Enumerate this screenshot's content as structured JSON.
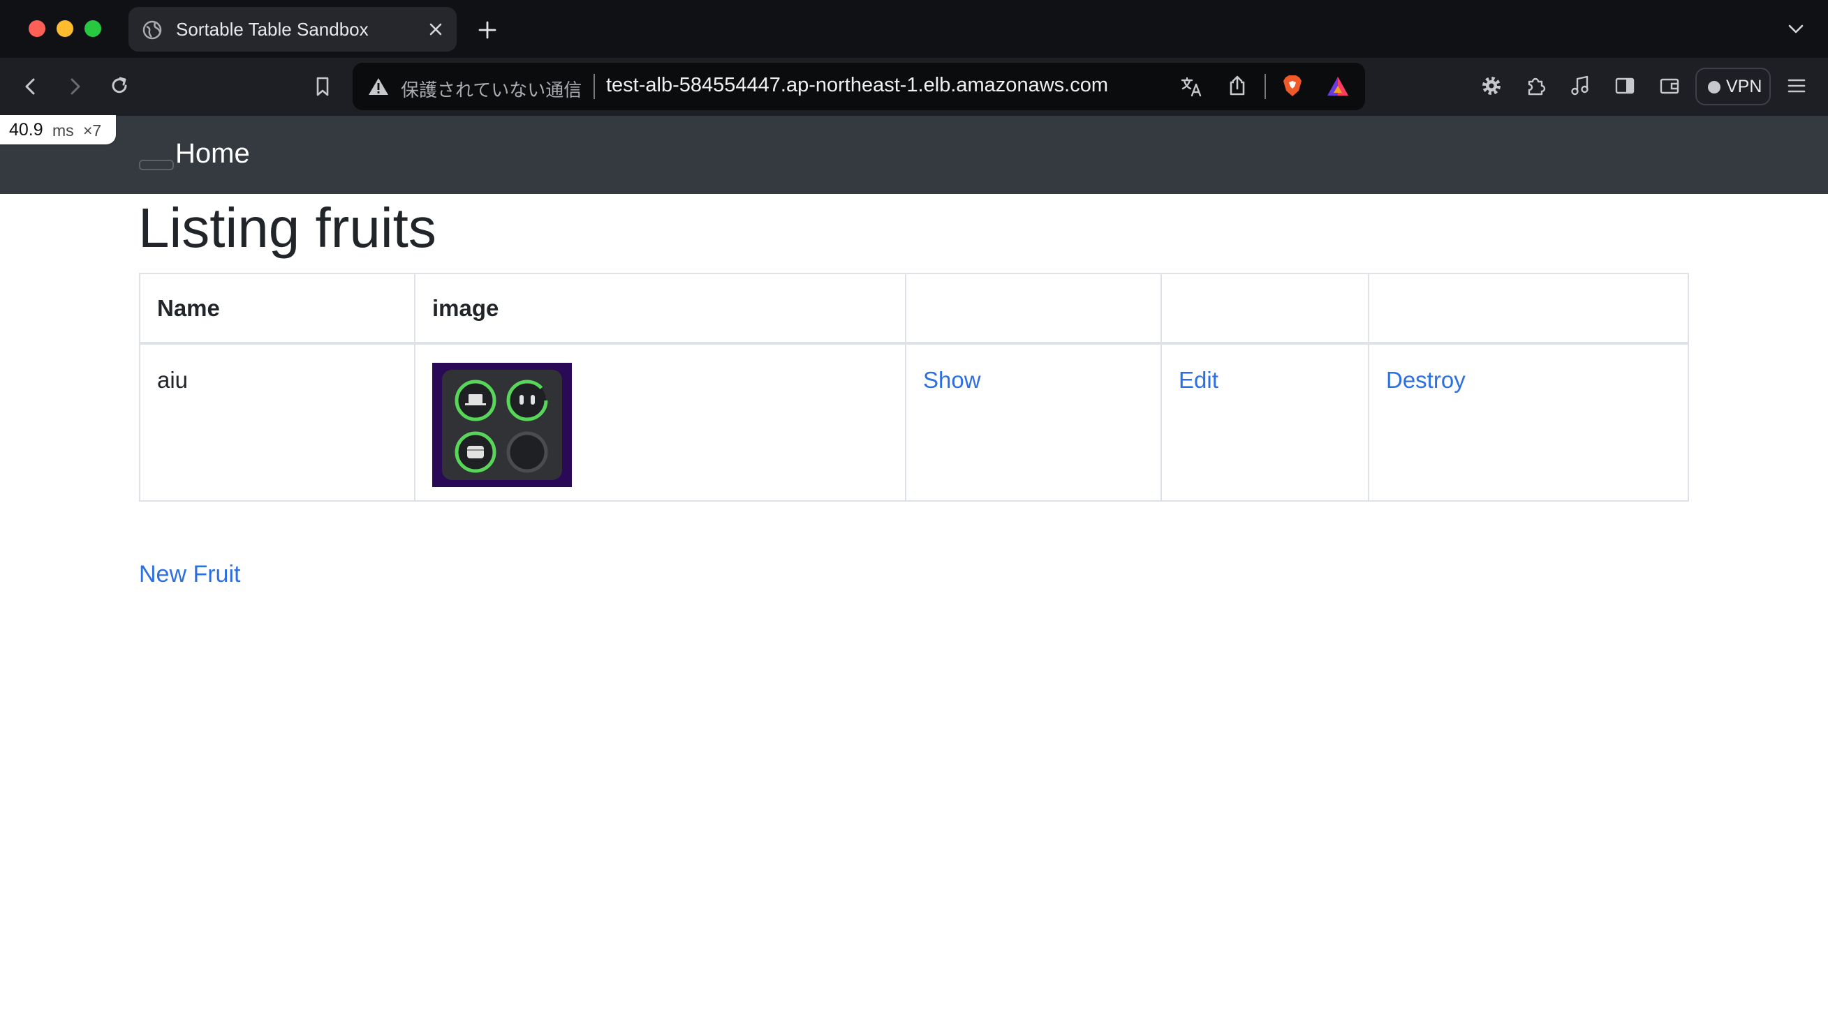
{
  "browser": {
    "tab_title": "Sortable Table Sandbox",
    "security_text": "保護されていない通信",
    "url": "test-alb-584554447.ap-northeast-1.elb.amazonaws.com",
    "vpn_label": "VPN",
    "tab_icon": "globe-icon",
    "toolbar_icons": [
      "back-icon",
      "forward-icon",
      "reload-icon",
      "bookmark-icon",
      "translate-icon",
      "share-icon",
      "brave-shields-icon",
      "brave-rewards-icon",
      "settings-gear-icon",
      "extensions-icon",
      "media-icon",
      "sidebar-icon",
      "wallet-icon",
      "menu-icon"
    ]
  },
  "perf_badge": {
    "ms": "40.9",
    "unit": "ms",
    "multiplier": "×7"
  },
  "navbar": {
    "home_label": "Home"
  },
  "page": {
    "title": "Listing fruits",
    "table": {
      "headers": [
        "Name",
        "image",
        "",
        "",
        ""
      ],
      "rows": [
        {
          "name": "aiu",
          "show": "Show",
          "edit": "Edit",
          "destroy": "Destroy"
        }
      ]
    },
    "new_fruit_label": "New Fruit"
  },
  "colors": {
    "link": "#2b6fe3",
    "navbar_bg": "#343a40",
    "browser_chrome": "#0f1115",
    "thumb_bg": "#2a0a57",
    "ring_green": "#57d659"
  }
}
